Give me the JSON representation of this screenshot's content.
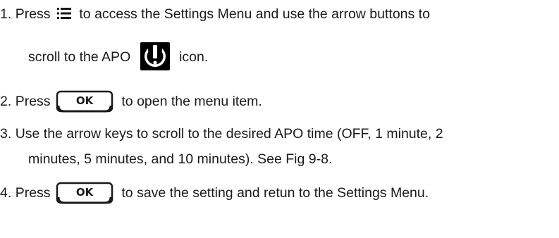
{
  "steps": [
    {
      "number": "1.",
      "text_a": "Press",
      "icon_a": "settings-menu-icon",
      "text_b": "to access the Settings Menu and use the arrow buttons to",
      "text_c": "scroll to the APO",
      "icon_b": "apo-power-icon",
      "text_d": "icon."
    },
    {
      "number": "2.",
      "text_a": "Press",
      "button": "OK",
      "text_b": "to open the menu item."
    },
    {
      "number": "3.",
      "text_a": "Use the arrow keys to scroll to the desired APO time (OFF, 1 minute, 2",
      "text_b": "minutes, 5 minutes, and 10 minutes). See Fig 9-8."
    },
    {
      "number": "4.",
      "text_a": "Press",
      "button": "OK",
      "text_b": "to save the setting and retun to the Settings Menu."
    }
  ]
}
